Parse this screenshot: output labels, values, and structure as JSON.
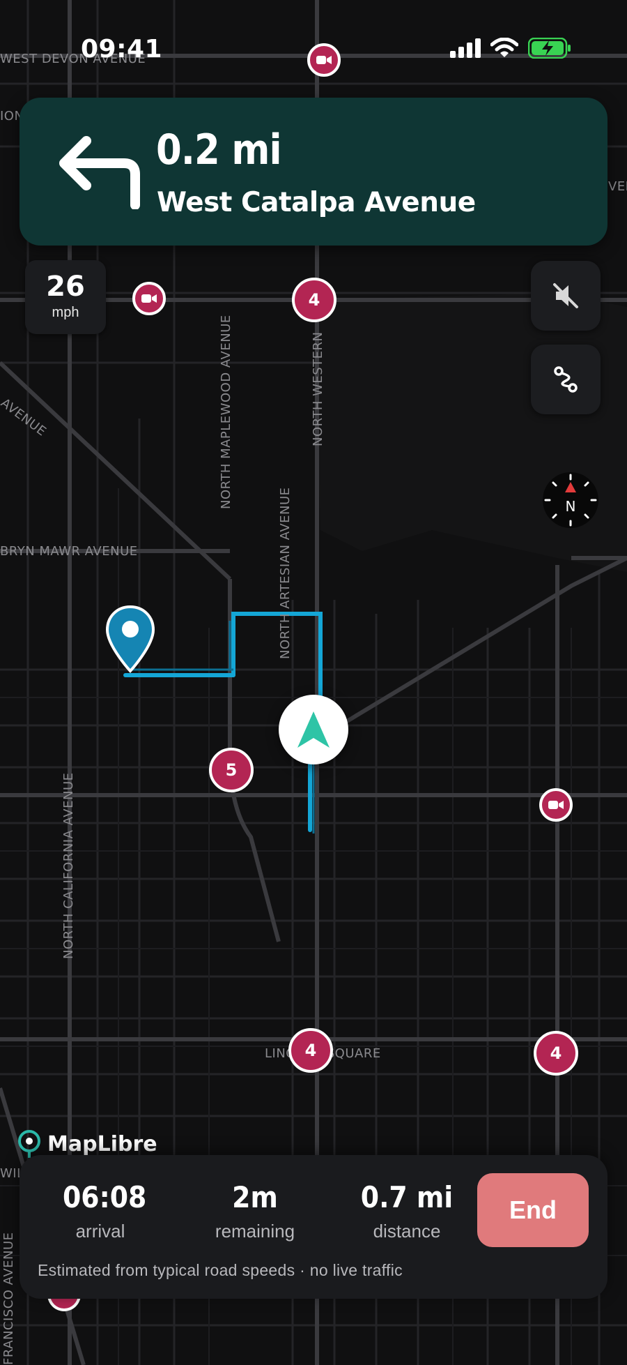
{
  "status_bar": {
    "time": "09:41"
  },
  "navigation": {
    "distance": "0.2 mi",
    "street": "West Catalpa Avenue",
    "maneuver_icon": "turn-left-arrow"
  },
  "speed": {
    "value": "26",
    "unit": "mph"
  },
  "controls": {
    "mute_icon": "speaker-muted-icon",
    "route_icon": "route-icon",
    "compass_label": "N"
  },
  "map_labels": {
    "west_devon": "WEST DEVON AVENUE",
    "north_maplewood": "NORTH MAPLEWOOD AVENUE",
    "north_western": "NORTH WESTERN",
    "north_artesian": "NORTH ARTESIAN AVENUE",
    "bryn_mawr": "BRYN MAWR AVENUE",
    "north_california": "NORTH CALIFORNIA AVENUE",
    "lincoln_square": "LINCOLN SQUARE",
    "avenue_diag": "AVENUE",
    "francisco": "FRANCISCO AVENUE",
    "left_frag1": "ION",
    "left_frag2": "WILS",
    "right_frag": "VEN"
  },
  "markers": {
    "num_4a": "4",
    "num_4b": "4",
    "num_4c": "4",
    "num_5": "5"
  },
  "attribution": "MapLibre",
  "trip": {
    "arrival_value": "06:08",
    "arrival_label": "arrival",
    "remaining_value": "2m",
    "remaining_label": "remaining",
    "distance_value": "0.7 mi",
    "distance_label": "distance",
    "end_label": "End",
    "note": "Estimated from typical road speeds · no live traffic"
  },
  "colors": {
    "banner": "#0f3634",
    "marker": "#b32553",
    "route": "#14a6d6",
    "end_button": "#e07a7c",
    "accent_arrow": "#2ec4a6"
  }
}
